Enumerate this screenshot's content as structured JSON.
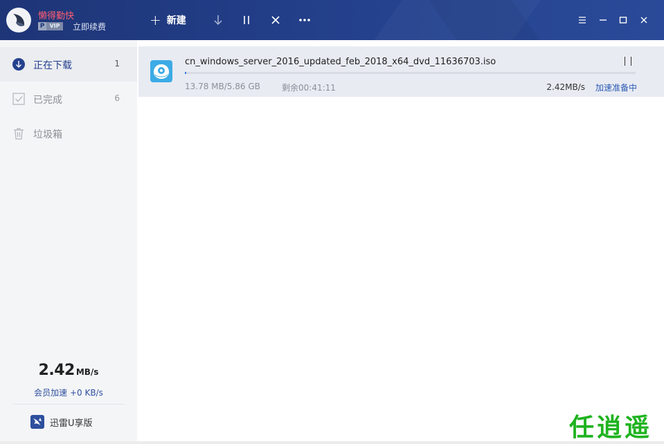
{
  "titlebar": {
    "username": "懒得勤快",
    "vip_badge_p": "P",
    "vip_badge_vip": "VIP",
    "renew": "立即续费",
    "new_label": "新建",
    "icons": [
      "plus-icon",
      "download-arrow-icon",
      "pause-all-icon",
      "delete-icon",
      "more-icon",
      "menu-icon",
      "minimize-icon",
      "maximize-icon",
      "close-icon"
    ]
  },
  "sidebar": {
    "items": [
      {
        "label": "正在下载",
        "count": "1",
        "icon": "downloading-icon"
      },
      {
        "label": "已完成",
        "count": "6",
        "icon": "completed-check-icon"
      },
      {
        "label": "垃圾箱",
        "count": "",
        "icon": "trash-icon"
      }
    ],
    "speed_value": "2.42",
    "speed_unit": "MB/s",
    "speed_sub": "会员加速 +0 KB/s",
    "u_edition": "迅雷U享版"
  },
  "downloads": [
    {
      "filename": "cn_windows_server_2016_updated_feb_2018_x64_dvd_11636703.iso",
      "size": "13.78 MB/5.86 GB",
      "remaining": "剩余00:41:11",
      "rate": "2.42MB/s",
      "accel_status": "加速准备中",
      "progress": 0.0023
    }
  ],
  "watermark": "任逍遥",
  "colors": {
    "titlebar": "#24418d",
    "accent": "#24418d",
    "link": "#2b5bb5",
    "username": "#ff5d73",
    "watermark": "#1fb31f",
    "file_icon": "#3cabe6"
  }
}
